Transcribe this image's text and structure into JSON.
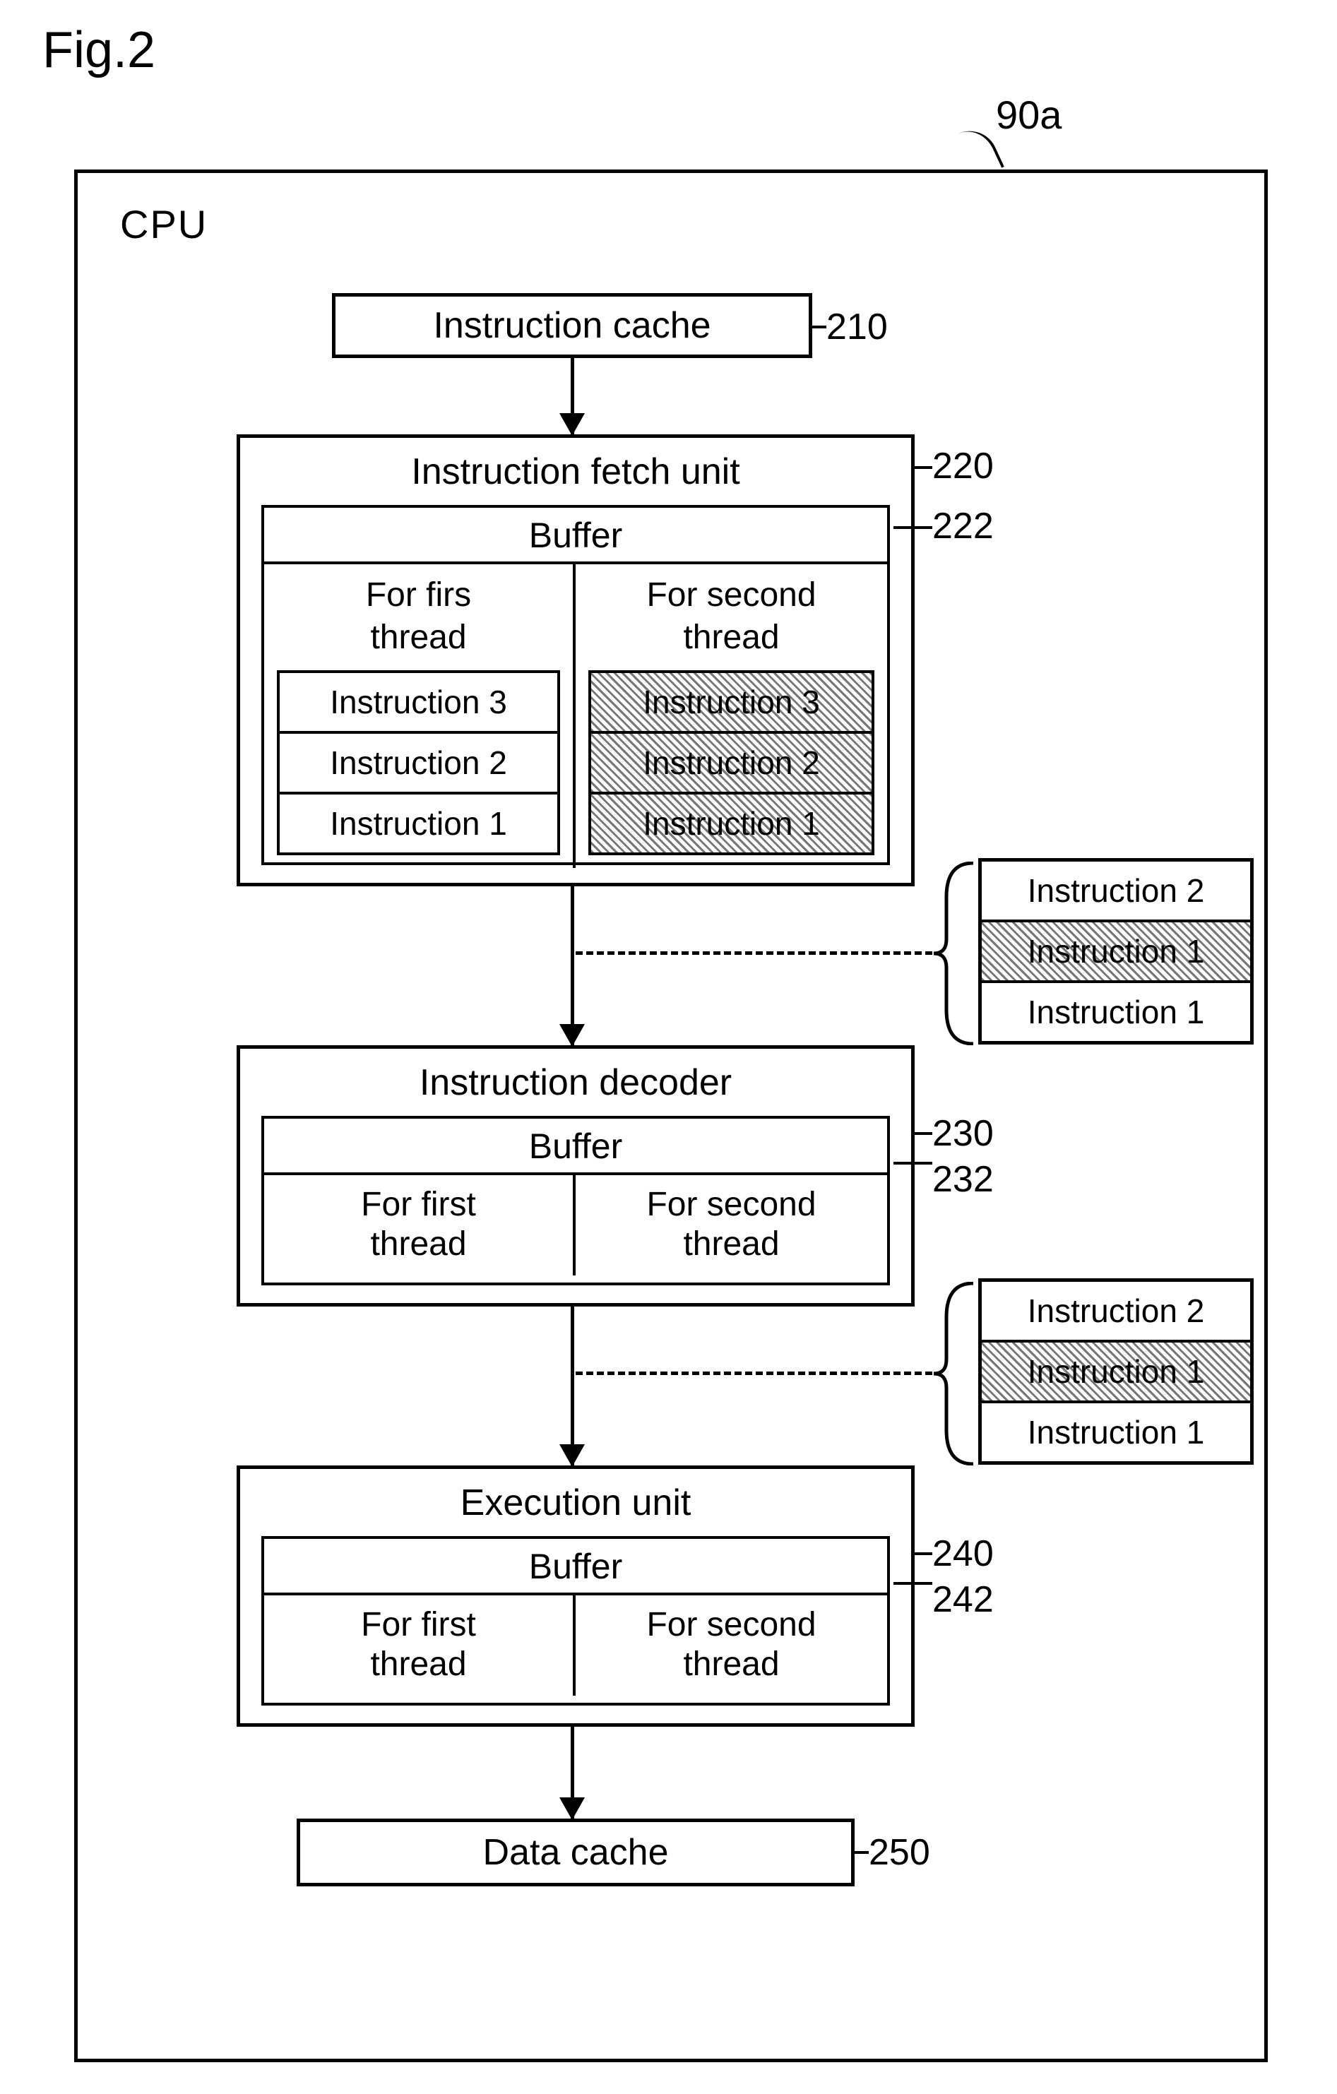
{
  "figure_label": "Fig.2",
  "outer_ref": "90a",
  "cpu_label": "CPU",
  "blocks": {
    "icache": {
      "label": "Instruction cache",
      "ref": "210"
    },
    "fetch": {
      "label": "Instruction fetch unit",
      "ref": "220",
      "buffer_label": "Buffer",
      "buffer_ref": "222",
      "col1_header_l1": "For firs",
      "col1_header_l2": "thread",
      "col2_header_l1": "For second",
      "col2_header_l2": "thread",
      "col1_items": [
        "Instruction 3",
        "Instruction 2",
        "Instruction 1"
      ],
      "col2_items": [
        "Instruction 3",
        "Instruction 2",
        "Instruction 1"
      ]
    },
    "decoder": {
      "label": "Instruction decoder",
      "ref": "230",
      "buffer_label": "Buffer",
      "buffer_ref": "232",
      "col1_l1": "For first",
      "col1_l2": "thread",
      "col2_l1": "For second",
      "col2_l2": "thread"
    },
    "exec": {
      "label": "Execution unit",
      "ref": "240",
      "buffer_label": "Buffer",
      "buffer_ref": "242",
      "col1_l1": "For first",
      "col1_l2": "thread",
      "col2_l1": "For second",
      "col2_l2": "thread"
    },
    "dcache": {
      "label": "Data cache",
      "ref": "250"
    }
  },
  "side_group_1": {
    "rows": [
      {
        "text": "Instruction 2",
        "hatched": false
      },
      {
        "text": "Instruction 1",
        "hatched": true
      },
      {
        "text": "Instruction 1",
        "hatched": false
      }
    ]
  },
  "side_group_2": {
    "rows": [
      {
        "text": "Instruction 2",
        "hatched": false
      },
      {
        "text": "Instruction 1",
        "hatched": true
      },
      {
        "text": "Instruction 1",
        "hatched": false
      }
    ]
  }
}
